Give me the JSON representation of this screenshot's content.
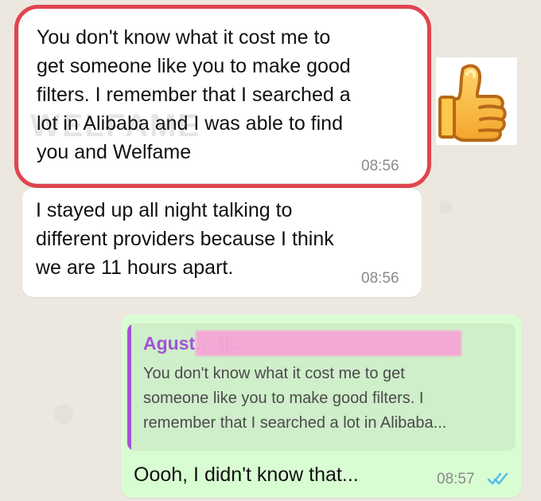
{
  "messages": [
    {
      "text": "You don't know what it cost me to\nget someone like you to make good\nfilters. I remember that I searched a\nlot in Alibaba and I was able to find\nyou and Welfame",
      "time": "08:56"
    },
    {
      "text": "I stayed up all night talking to\ndifferent providers because I think\nwe are 11 hours apart.",
      "time": "08:56"
    }
  ],
  "reply": {
    "author": "Agust… ti...",
    "quoted_text": "You don't know what it cost me to get\nsomeone like you to make good filters. I\nremember that I searched a lot in Alibaba...",
    "text": "Oooh, I didn't know that...",
    "time": "08:57"
  },
  "watermark_text": "WELFAME",
  "colors": {
    "highlight": "#e0454f",
    "reply_accent": "#a451d8",
    "outgoing_bubble": "#d9fdd3",
    "read_ticks": "#53bdeb"
  },
  "icons": {
    "sticker": "thumbs-up-icon",
    "ticks": "double-check-icon"
  }
}
